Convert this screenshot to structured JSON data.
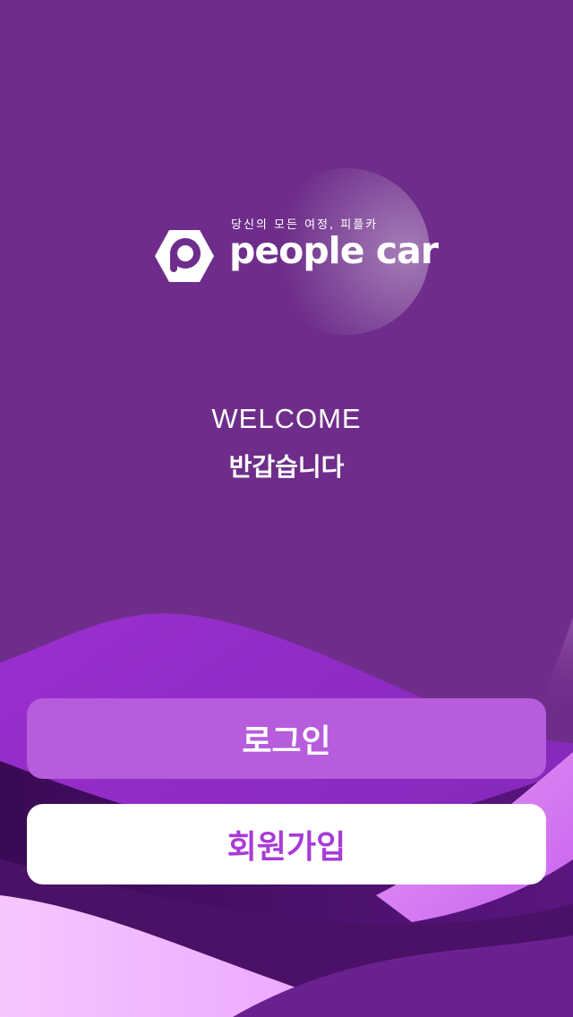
{
  "colors": {
    "background": "#6e2d8a",
    "login_button": "#b65cdc",
    "signup_button": "#ffffff",
    "signup_text": "#a83bd6"
  },
  "brand": {
    "tagline": "당신의 모든 여정, 피플카",
    "name": "people car",
    "logo_icon": "hexagon-p-logo-icon"
  },
  "welcome": {
    "title": "WELCOME",
    "subtitle": "반갑습니다"
  },
  "buttons": {
    "login_label": "로그인",
    "signup_label": "회원가입"
  }
}
